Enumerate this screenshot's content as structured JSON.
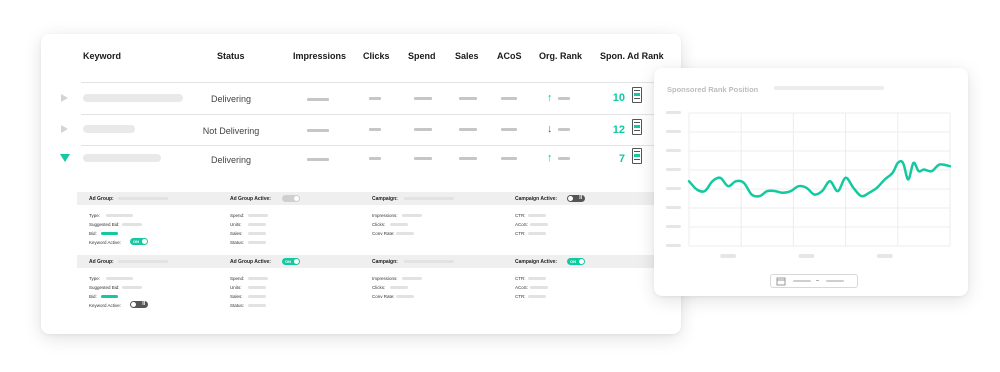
{
  "table": {
    "columns": [
      "Keyword",
      "Status",
      "Impressions",
      "Clicks",
      "Spend",
      "Sales",
      "ACoS",
      "Org. Rank",
      "Spon. Ad Rank"
    ],
    "rows": [
      {
        "status": "Delivering",
        "org_rank_trend": "up",
        "spon_ad_rank": "10",
        "expanded": false
      },
      {
        "status": "Not Delivering",
        "org_rank_trend": "down",
        "spon_ad_rank": "12",
        "expanded": false
      },
      {
        "status": "Delivering",
        "org_rank_trend": "up",
        "spon_ad_rank": "7",
        "expanded": true
      }
    ]
  },
  "details": [
    {
      "ad_group_label": "Ad Group:",
      "ad_group_active_label": "Ad Group Active:",
      "campaign_label": "Campaign:",
      "campaign_active_label": "Campaign Active:",
      "col1": [
        "Type:",
        "Suggested Bid:",
        "Bid:",
        "Keyword Active:"
      ],
      "col2": [
        "Spend:",
        "Units:",
        "Sales:",
        "Status:"
      ],
      "col3": [
        "Impressions:",
        "Clicks:",
        "Conv Rate:"
      ],
      "col4": [
        "CTR:",
        "ACoS:",
        "CTR:"
      ],
      "keyword_toggle": "ON",
      "campaign_toggle": "II"
    },
    {
      "ad_group_label": "Ad Group:",
      "ad_group_active_label": "Ad Group Active:",
      "campaign_label": "Campaign:",
      "campaign_active_label": "Campaign Active:",
      "col1": [
        "Type:",
        "Suggested Bid:",
        "Bid:",
        "Keyword Active:"
      ],
      "col2": [
        "Spend:",
        "Units:",
        "Sales:",
        "Status:"
      ],
      "col3": [
        "Impressions:",
        "Clicks:",
        "Conv Rate:"
      ],
      "col4": [
        "CTR:",
        "ACoS:",
        "CTR:"
      ],
      "ad_group_toggle": "ON",
      "campaign_toggle": "ON",
      "keyword_toggle": "II"
    }
  ],
  "chart": {
    "title": "Sponsored Rank Position"
  },
  "colors": {
    "accent": "#12c9a0",
    "down": "#d3313a"
  },
  "chart_data": {
    "type": "line",
    "title": "Sponsored Rank Position",
    "xlabel": "",
    "ylabel": "",
    "grid": true,
    "xlim": [
      0,
      100
    ],
    "ylim": [
      0,
      8
    ],
    "series": [
      {
        "values": [
          [
            0,
            3.9
          ],
          [
            3,
            3.4
          ],
          [
            6,
            3.3
          ],
          [
            9,
            3.9
          ],
          [
            12,
            4.1
          ],
          [
            15,
            3.6
          ],
          [
            18,
            3.9
          ],
          [
            21,
            3.8
          ],
          [
            24,
            3.1
          ],
          [
            27,
            3.0
          ],
          [
            30,
            3.3
          ],
          [
            33,
            3.3
          ],
          [
            36,
            3.2
          ],
          [
            39,
            3.3
          ],
          [
            42,
            3.6
          ],
          [
            45,
            3.5
          ],
          [
            48,
            3.1
          ],
          [
            51,
            3.3
          ],
          [
            54,
            3.9
          ],
          [
            57,
            3.3
          ],
          [
            60,
            4.1
          ],
          [
            63,
            3.5
          ],
          [
            66,
            3.0
          ],
          [
            69,
            3.2
          ],
          [
            72,
            3.5
          ],
          [
            75,
            4.0
          ],
          [
            78,
            4.4
          ],
          [
            80,
            5.0
          ],
          [
            82,
            5.0
          ],
          [
            84,
            4.0
          ],
          [
            86,
            5.0
          ],
          [
            88,
            4.5
          ],
          [
            90,
            4.6
          ],
          [
            93,
            4.5
          ],
          [
            96,
            4.9
          ],
          [
            100,
            4.8
          ]
        ]
      }
    ]
  }
}
